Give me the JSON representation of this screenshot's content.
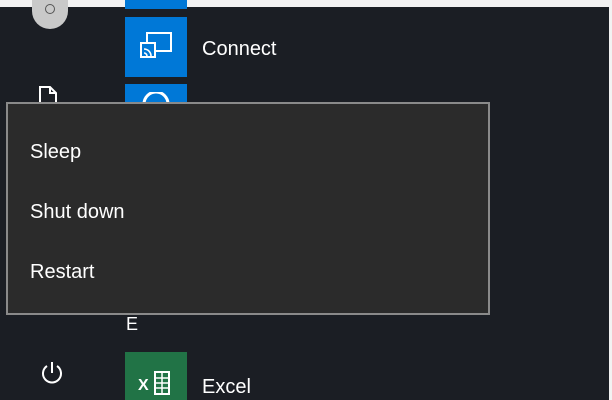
{
  "start_menu": {
    "apps": [
      {
        "label": "Connect",
        "icon": "connect-icon"
      },
      {
        "label": "Excel",
        "icon": "excel-icon"
      }
    ],
    "group_letter": "E",
    "excel_tile_text": "X"
  },
  "power_menu": {
    "items": [
      {
        "label": "Sleep"
      },
      {
        "label": "Shut down"
      },
      {
        "label": "Restart"
      }
    ]
  },
  "colors": {
    "background": "#1b1e24",
    "accent_tile": "#0078d7",
    "excel_tile": "#217346",
    "menu_background": "#2b2b2b",
    "menu_border": "#8a8a8a"
  }
}
